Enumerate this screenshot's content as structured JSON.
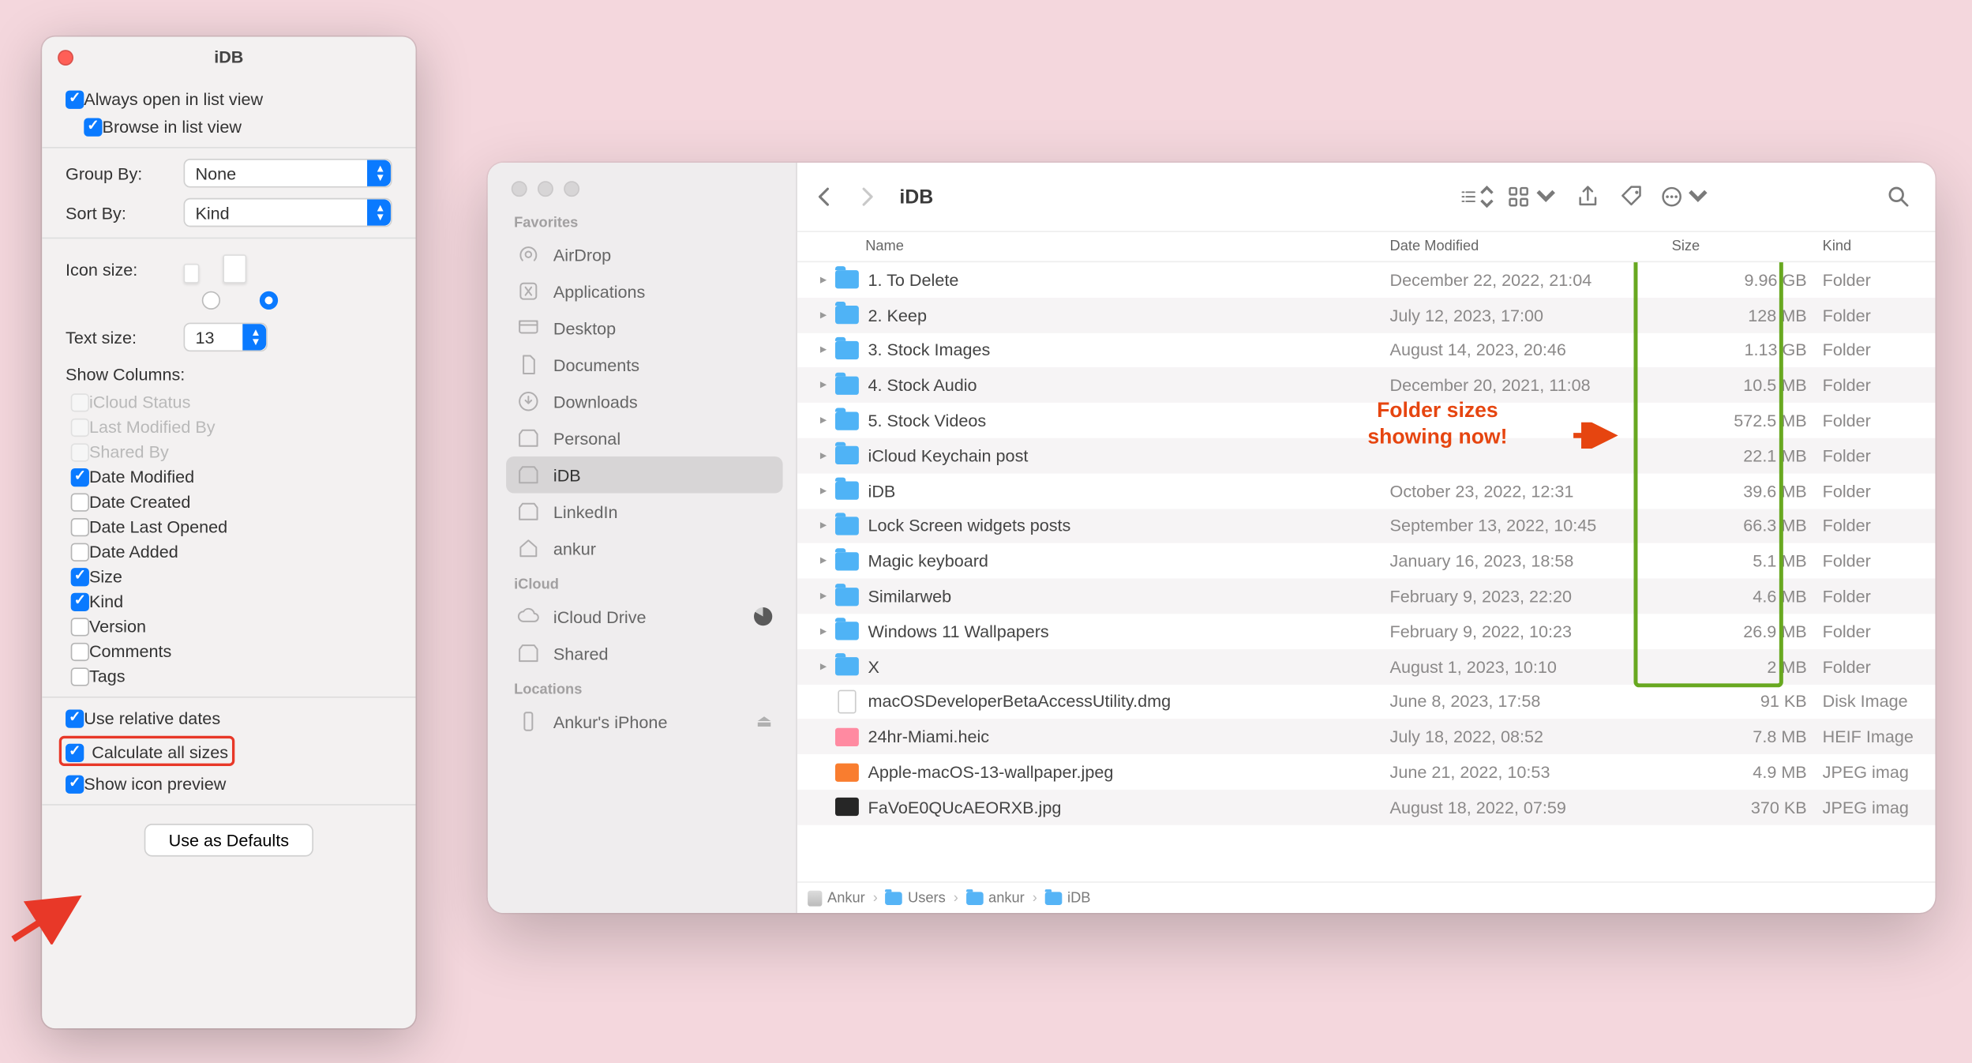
{
  "view_options": {
    "title": "iDB",
    "always_open_list": "Always open in list view",
    "browse_list": "Browse in list view",
    "group_by_label": "Group By:",
    "group_by_value": "None",
    "sort_by_label": "Sort By:",
    "sort_by_value": "Kind",
    "icon_size_label": "Icon size:",
    "text_size_label": "Text size:",
    "text_size_value": "13",
    "show_columns_label": "Show Columns:",
    "columns": {
      "icloud_status": "iCloud Status",
      "last_modified_by": "Last Modified By",
      "shared_by": "Shared By",
      "date_modified": "Date Modified",
      "date_created": "Date Created",
      "date_last_opened": "Date Last Opened",
      "date_added": "Date Added",
      "size": "Size",
      "kind": "Kind",
      "version": "Version",
      "comments": "Comments",
      "tags": "Tags"
    },
    "use_relative_dates": "Use relative dates",
    "calculate_all_sizes": "Calculate all sizes",
    "show_icon_preview": "Show icon preview",
    "use_as_defaults": "Use as Defaults"
  },
  "finder": {
    "title": "iDB",
    "sidebar": {
      "favorites_header": "Favorites",
      "favorites": [
        "AirDrop",
        "Applications",
        "Desktop",
        "Documents",
        "Downloads",
        "Personal",
        "iDB",
        "LinkedIn",
        "ankur"
      ],
      "icloud_header": "iCloud",
      "icloud": [
        "iCloud Drive",
        "Shared"
      ],
      "locations_header": "Locations",
      "locations": [
        "Ankur's iPhone"
      ]
    },
    "columns": {
      "name": "Name",
      "date": "Date Modified",
      "size": "Size",
      "kind": "Kind"
    },
    "rows": [
      {
        "name": "1. To Delete",
        "date": "December 22, 2022, 21:04",
        "size": "9.96 GB",
        "kind": "Folder",
        "type": "folder"
      },
      {
        "name": "2. Keep",
        "date": "July 12, 2023, 17:00",
        "size": "128 MB",
        "kind": "Folder",
        "type": "folder"
      },
      {
        "name": "3. Stock Images",
        "date": "August 14, 2023, 20:46",
        "size": "1.13 GB",
        "kind": "Folder",
        "type": "folder"
      },
      {
        "name": "4. Stock Audio",
        "date": "December 20, 2021, 11:08",
        "size": "10.5 MB",
        "kind": "Folder",
        "type": "folder"
      },
      {
        "name": "5. Stock Videos",
        "date": "",
        "size": "572.5 MB",
        "kind": "Folder",
        "type": "folder"
      },
      {
        "name": "iCloud Keychain post",
        "date": "",
        "size": "22.1 MB",
        "kind": "Folder",
        "type": "folder"
      },
      {
        "name": "iDB",
        "date": "October 23, 2022, 12:31",
        "size": "39.6 MB",
        "kind": "Folder",
        "type": "folder"
      },
      {
        "name": "Lock Screen widgets posts",
        "date": "September 13, 2022, 10:45",
        "size": "66.3 MB",
        "kind": "Folder",
        "type": "folder"
      },
      {
        "name": "Magic keyboard",
        "date": "January 16, 2023, 18:58",
        "size": "5.1 MB",
        "kind": "Folder",
        "type": "folder"
      },
      {
        "name": "Similarweb",
        "date": "February 9, 2023, 22:20",
        "size": "4.6 MB",
        "kind": "Folder",
        "type": "folder"
      },
      {
        "name": "Windows 11 Wallpapers",
        "date": "February 9, 2022, 10:23",
        "size": "26.9 MB",
        "kind": "Folder",
        "type": "folder"
      },
      {
        "name": "X",
        "date": "August 1, 2023, 10:10",
        "size": "2 MB",
        "kind": "Folder",
        "type": "folder"
      },
      {
        "name": "macOSDeveloperBetaAccessUtility.dmg",
        "date": "June 8, 2023, 17:58",
        "size": "91 KB",
        "kind": "Disk Image",
        "type": "dmg"
      },
      {
        "name": "24hr-Miami.heic",
        "date": "July 18, 2022, 08:52",
        "size": "7.8 MB",
        "kind": "HEIF Image",
        "type": "img",
        "bg": "#ff8aa1"
      },
      {
        "name": "Apple-macOS-13-wallpaper.jpeg",
        "date": "June 21, 2022, 10:53",
        "size": "4.9 MB",
        "kind": "JPEG imag",
        "type": "img",
        "bg": "#f97d2f"
      },
      {
        "name": "FaVoE0QUcAEORXB.jpg",
        "date": "August 18, 2022, 07:59",
        "size": "370 KB",
        "kind": "JPEG imag",
        "type": "img",
        "bg": "#262626"
      }
    ],
    "path": [
      "Ankur",
      "Users",
      "ankur",
      "iDB"
    ],
    "annotation": "Folder sizes\nshowing now!"
  }
}
